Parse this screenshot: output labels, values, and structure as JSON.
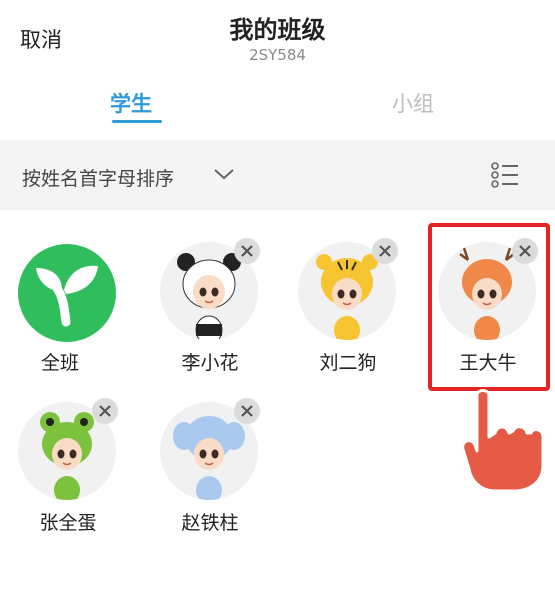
{
  "header": {
    "cancel_label": "取消",
    "title": "我的班级",
    "class_code": "2SY584"
  },
  "tabs": [
    {
      "label": "学生",
      "active": true
    },
    {
      "label": "小组",
      "active": false
    }
  ],
  "sortbar": {
    "sort_label": "按姓名首字母排序",
    "list_view_icon": "list-view-icon"
  },
  "students": [
    {
      "name": "全班",
      "avatar": "sprout-icon",
      "removable": false
    },
    {
      "name": "李小花",
      "avatar": "panda-avatar",
      "removable": true
    },
    {
      "name": "刘二狗",
      "avatar": "tiger-avatar",
      "removable": true
    },
    {
      "name": "王大牛",
      "avatar": "deer-avatar",
      "removable": true,
      "highlighted": true
    },
    {
      "name": "张全蛋",
      "avatar": "frog-avatar",
      "removable": true
    },
    {
      "name": "赵铁柱",
      "avatar": "elephant-avatar",
      "removable": true
    }
  ],
  "colors": {
    "accent": "#2e9bd6",
    "highlight": "#e32424",
    "all_class_green": "#2fbd5d"
  }
}
